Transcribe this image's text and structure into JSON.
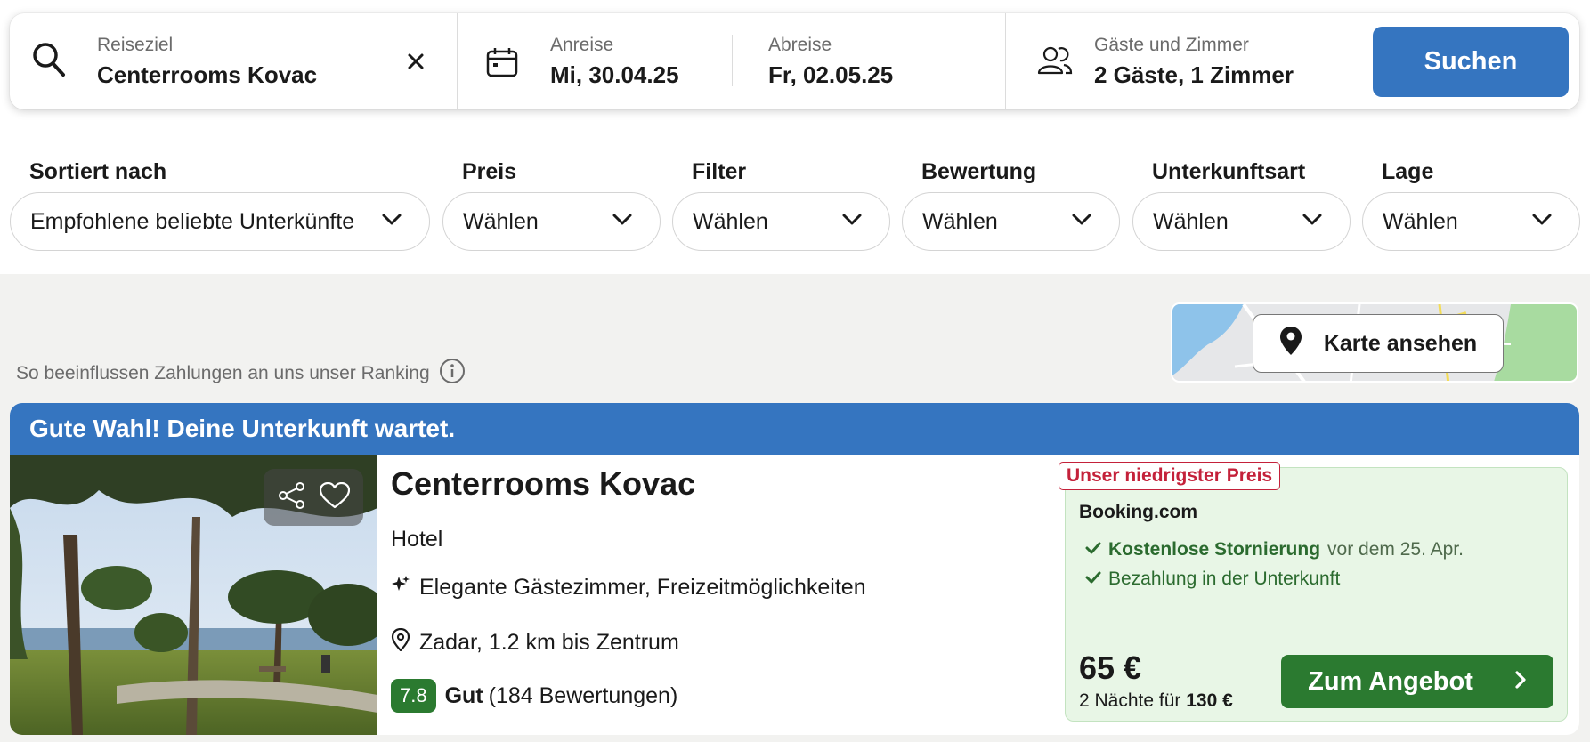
{
  "search": {
    "destination": {
      "label": "Reiseziel",
      "value": "Centerrooms Kovac"
    },
    "checkin": {
      "label": "Anreise",
      "value": "Mi, 30.04.25"
    },
    "checkout": {
      "label": "Abreise",
      "value": "Fr, 02.05.25"
    },
    "guests": {
      "label": "Gäste und Zimmer",
      "value": "2 Gäste, 1 Zimmer"
    },
    "submit_label": "Suchen"
  },
  "filters": [
    {
      "label": "Sortiert nach",
      "value": "Empfohlene beliebte Unterkünfte"
    },
    {
      "label": "Preis",
      "value": "Wählen"
    },
    {
      "label": "Filter",
      "value": "Wählen"
    },
    {
      "label": "Bewertung",
      "value": "Wählen"
    },
    {
      "label": "Unterkunftsart",
      "value": "Wählen"
    },
    {
      "label": "Lage",
      "value": "Wählen"
    }
  ],
  "ranking_note": "So beeinflussen Zahlungen an uns unser Ranking",
  "map": {
    "button_label": "Karte ansehen"
  },
  "result": {
    "banner": "Gute Wahl! Deine Unterkunft wartet.",
    "name": "Centerrooms Kovac",
    "type": "Hotel",
    "highlights": "Elegante Gästezimmer, Freizeitmöglichkeiten",
    "location": "Zadar, 1.2 km bis Zentrum",
    "rating_score": "7.8",
    "rating_text": "Gut",
    "rating_count": "(184 Bewertungen)",
    "offer": {
      "tag": "Unser niedrigster Preis",
      "provider": "Booking.com",
      "cancellation_bold": "Kostenlose Stornierung",
      "cancellation_rest": "vor dem 25. Apr.",
      "payment": "Bezahlung in der Unterkunft",
      "price": "65 €",
      "nights_prefix": "2 Nächte für",
      "nights_total": "130 €",
      "cta": "Zum Angebot"
    }
  },
  "colors": {
    "accent_blue": "#3575c0",
    "offer_green": "#2b7a30",
    "tag_red": "#c4213a"
  }
}
